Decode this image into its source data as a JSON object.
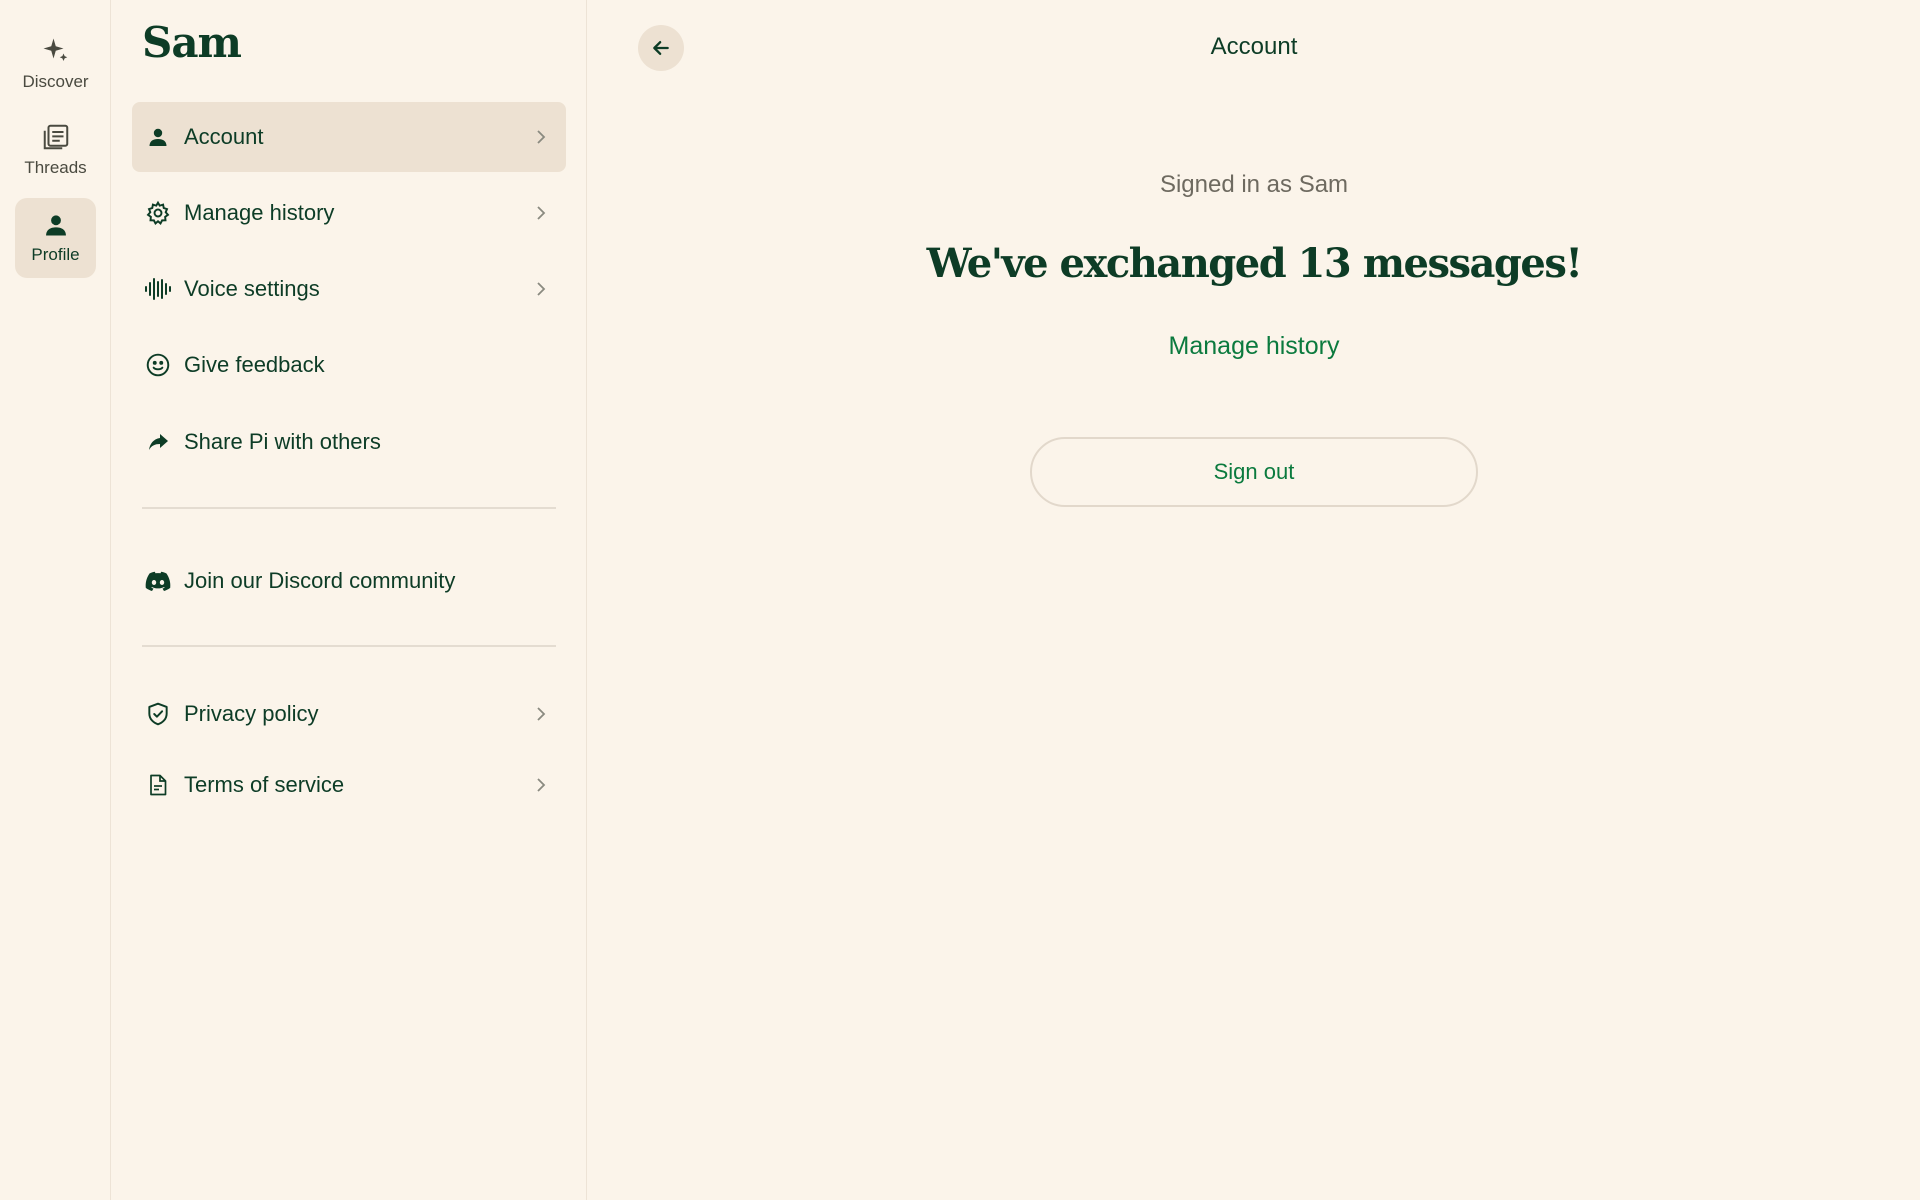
{
  "rail": {
    "items": [
      {
        "label": "Discover",
        "icon": "sparkle-icon",
        "active": false
      },
      {
        "label": "Threads",
        "icon": "threads-icon",
        "active": false
      },
      {
        "label": "Profile",
        "icon": "person-icon",
        "active": true
      }
    ]
  },
  "panel": {
    "title": "Sam",
    "items": [
      {
        "label": "Account",
        "icon": "person-icon",
        "chevron": true,
        "active": true
      },
      {
        "label": "Manage history",
        "icon": "gear-icon",
        "chevron": true
      },
      {
        "label": "Voice settings",
        "icon": "waveform-icon",
        "chevron": true
      },
      {
        "label": "Give feedback",
        "icon": "smiley-icon",
        "chevron": false
      },
      {
        "label": "Share Pi with others",
        "icon": "share-arrow-icon",
        "chevron": false
      },
      {
        "label": "Join our Discord community",
        "icon": "discord-icon",
        "chevron": false
      },
      {
        "label": "Privacy policy",
        "icon": "shield-check-icon",
        "chevron": true
      },
      {
        "label": "Terms of service",
        "icon": "document-icon",
        "chevron": true
      }
    ]
  },
  "main": {
    "header_title": "Account",
    "signed_in_text": "Signed in as Sam",
    "headline": "We've exchanged 13 messages!",
    "manage_history_link": "Manage history",
    "sign_out_label": "Sign out"
  },
  "colors": {
    "background": "#FBF4EA",
    "primary_text": "#0D3C26",
    "accent_green": "#0B7A3E",
    "active_bg": "#EDE1D2",
    "muted_text": "#6E6A60"
  }
}
